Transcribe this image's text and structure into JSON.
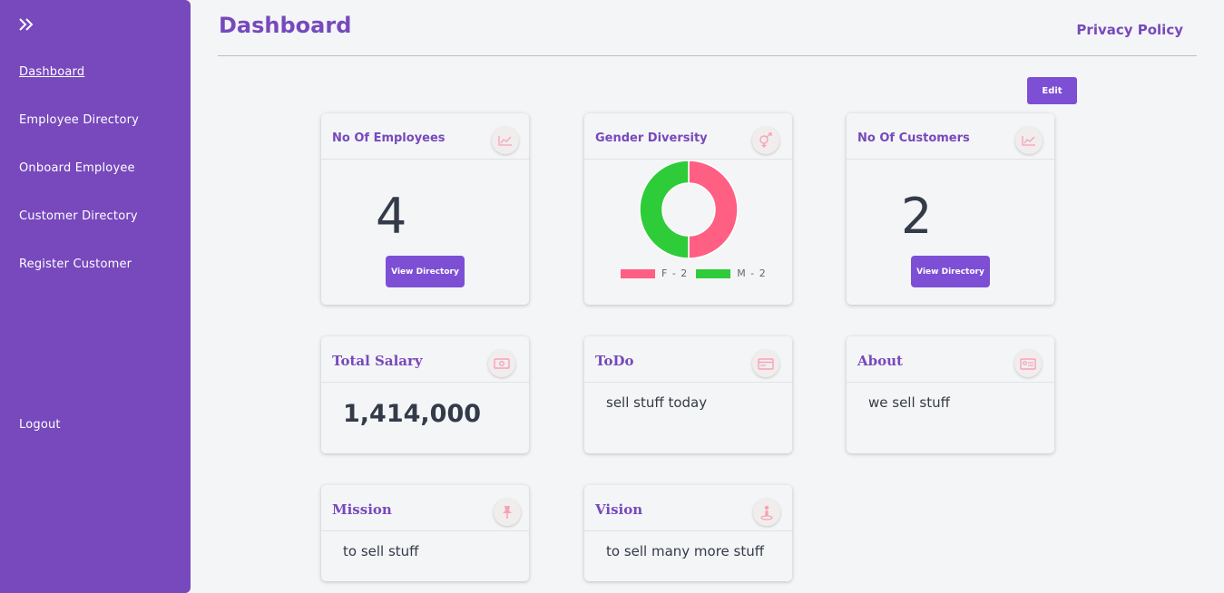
{
  "sidebar": {
    "toggle_icon": "double-chevron-right-icon",
    "items": [
      {
        "label": "Dashboard",
        "active": true
      },
      {
        "label": "Employee Directory"
      },
      {
        "label": "Onboard Employee"
      },
      {
        "label": "Customer Directory"
      },
      {
        "label": "Register Customer"
      }
    ],
    "logout": "Logout"
  },
  "header": {
    "title": "Dashboard",
    "privacy": "Privacy Policy",
    "edit": "Edit"
  },
  "cards": {
    "employees": {
      "title": "No Of Employees",
      "value": "4",
      "button": "View Directory",
      "icon": "trend-chart-icon"
    },
    "gender": {
      "title": "Gender Diversity",
      "icon": "gender-icon",
      "legend_f": "F - 2",
      "legend_m": "M - 2"
    },
    "customers": {
      "title": "No Of Customers",
      "value": "2",
      "button": "View Directory",
      "icon": "trend-chart-icon"
    },
    "salary": {
      "title": "Total Salary",
      "value": "1,414,000",
      "icon": "money-icon"
    },
    "todo": {
      "title": "ToDo",
      "value": "sell stuff today",
      "icon": "card-icon"
    },
    "about": {
      "title": "About",
      "value": "we sell stuff",
      "icon": "id-card-icon"
    },
    "mission": {
      "title": "Mission",
      "value": "to sell stuff",
      "icon": "pin-icon"
    },
    "vision": {
      "title": "Vision",
      "value": "to sell many more stuff",
      "icon": "person-pin-icon"
    }
  },
  "chart_data": {
    "type": "pie",
    "categories": [
      "F",
      "M"
    ],
    "values": [
      2,
      2
    ],
    "colors": [
      "#ff5f82",
      "#2fcc3a"
    ],
    "legend": "bottom"
  },
  "colors": {
    "accent": "#7749bc",
    "button": "#7d4fd4",
    "female": "#ff5f82",
    "male": "#2fcc3a"
  }
}
